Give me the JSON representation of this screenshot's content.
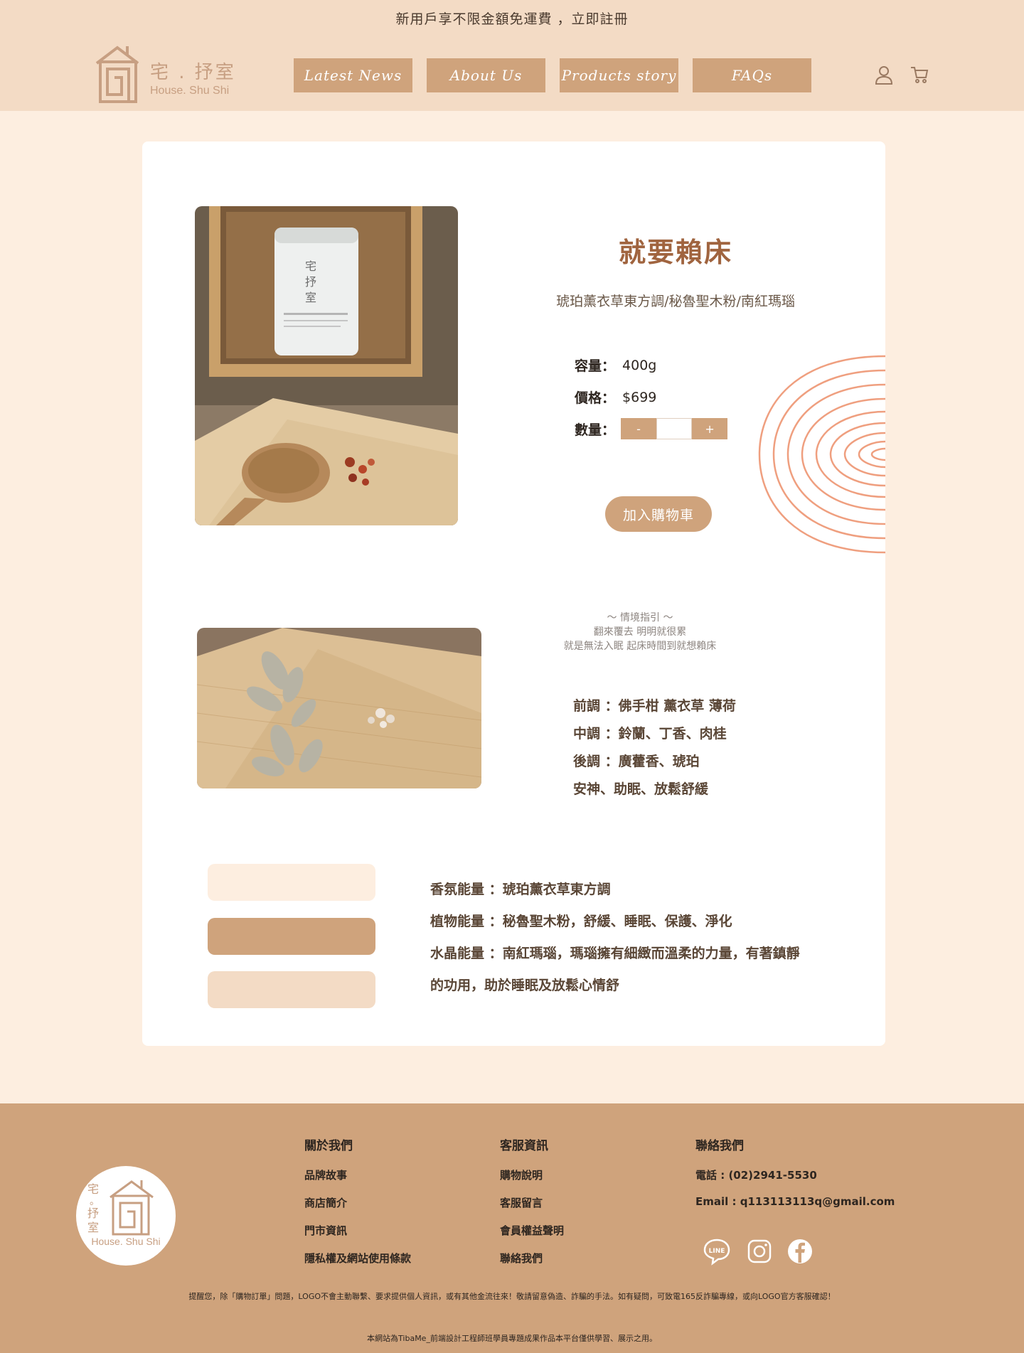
{
  "promo": {
    "text": "新用戶享不限金額免運費 ，立即註冊"
  },
  "logo": {
    "cn": "宅 . 抒室",
    "en": "House. Shu Shi"
  },
  "nav": {
    "items": [
      "Latest News",
      "About Us",
      "Products story",
      "FAQs"
    ]
  },
  "header_icons": [
    "user-icon",
    "cart-icon"
  ],
  "product": {
    "title": "就要賴床",
    "subtitle": "琥珀薰衣草東方調/秘魯聖木粉/南紅瑪瑙",
    "capacity_label": "容量：",
    "capacity_value": "400g",
    "price_label": "價格：",
    "price_value": "$699",
    "quantity_label": "數量：",
    "quantity_value": "",
    "minus_label": "-",
    "plus_label": "+",
    "add_to_cart": "加入購物車"
  },
  "scene": {
    "heading": "～ 情境指引 ～",
    "line1": "翻來覆去 明明就很累",
    "line2": "就是無法入眠 起床時間到就想賴床"
  },
  "notes": {
    "top": "前調 ：佛手柑 薰衣草 薄荷",
    "middle": "中調 ：鈴蘭、丁香、肉桂",
    "base": "後調 ：廣藿香、琥珀",
    "effect": "安神、助眠、放鬆舒緩"
  },
  "energy": {
    "aroma": "香氛能量 ：琥珀薰衣草東方調",
    "plant": "植物能量 ：秘魯聖木粉，舒緩、睡眠、保護、淨化",
    "crystal_1": "水晶能量 ：南紅瑪瑙，瑪瑙擁有細緻而溫柔的力量，有著鎮靜",
    "crystal_2": "的功用，助於睡眠及放鬆心情舒"
  },
  "swatches": [
    "#fdeee0",
    "#cfa37c",
    "#f3dbc5"
  ],
  "colors": {
    "accent": "#cfa37c",
    "title": "#a0643f",
    "header_bg": "#f3dbc5",
    "page_bg": "#fdeee0",
    "rings": "#ef9f7f"
  },
  "footer": {
    "logo_cn": "宅。抒室",
    "logo_en": "House. Shu Shi",
    "about": {
      "heading": "關於我們",
      "items": [
        "品牌故事",
        "商店簡介",
        "門市資訊",
        "隱私權及網站使用條款"
      ]
    },
    "service": {
      "heading": "客服資訊",
      "items": [
        "購物說明",
        "客服留言",
        "會員權益聲明",
        "聯絡我們"
      ]
    },
    "contact": {
      "heading": "聯絡我們",
      "phone": "電話 : (02)2941-5530",
      "email": "Email : q113113113q@gmail.com"
    },
    "social": [
      "line-icon",
      "instagram-icon",
      "facebook-icon"
    ],
    "line_text": "LINE",
    "warning": "提醒您，除「購物訂單」問題，LOGO不會主動聯繫、要求提供個人資訊，或有其他金流往來！敬請留意偽造、詐騙的手法。如有疑問，可致電165反詐騙專線，或向LOGO官方客服確認！",
    "disclaimer": "本網站為TibaMe_前端設計工程師班學員專題成果作品本平台僅供學習、展示之用。"
  }
}
